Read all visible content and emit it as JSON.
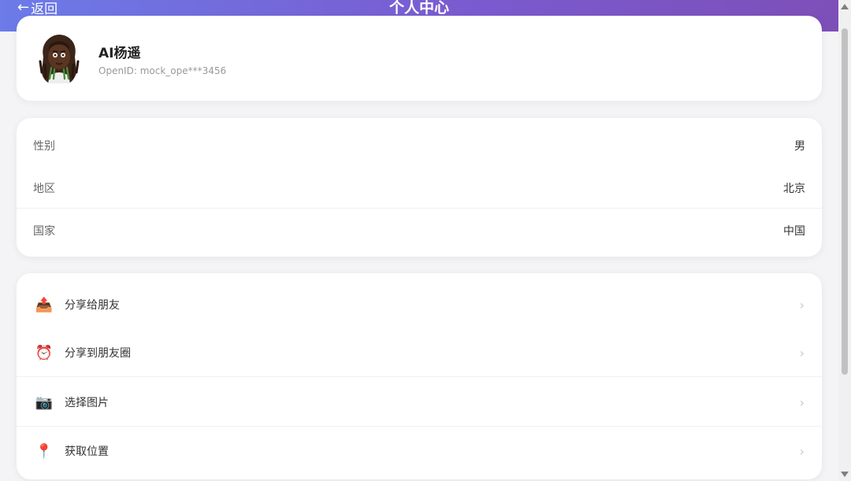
{
  "header": {
    "back_arrow": "←",
    "back_label": "返回",
    "title": "个人中心",
    "gradient_colors": [
      "#6c7be8",
      "#7d4fb8"
    ]
  },
  "profile": {
    "name": "AI杨遥",
    "openid": "OpenID: mock_ope***3456"
  },
  "info": {
    "rows": [
      {
        "label": "性别",
        "value": "男"
      },
      {
        "label": "地区",
        "value": "北京"
      },
      {
        "label": "国家",
        "value": "中国"
      }
    ]
  },
  "actions": {
    "items": [
      {
        "icon": "📤",
        "icon_name": "share-icon",
        "label": "分享给朋友",
        "chevron": "›"
      },
      {
        "icon": "⏰",
        "icon_name": "alarm-clock-icon",
        "label": "分享到朋友圈",
        "chevron": "›"
      },
      {
        "icon": "📷",
        "icon_name": "camera-icon",
        "label": "选择图片",
        "chevron": "›"
      },
      {
        "icon": "📍",
        "icon_name": "location-pin-icon",
        "label": "获取位置",
        "chevron": "›"
      }
    ]
  }
}
